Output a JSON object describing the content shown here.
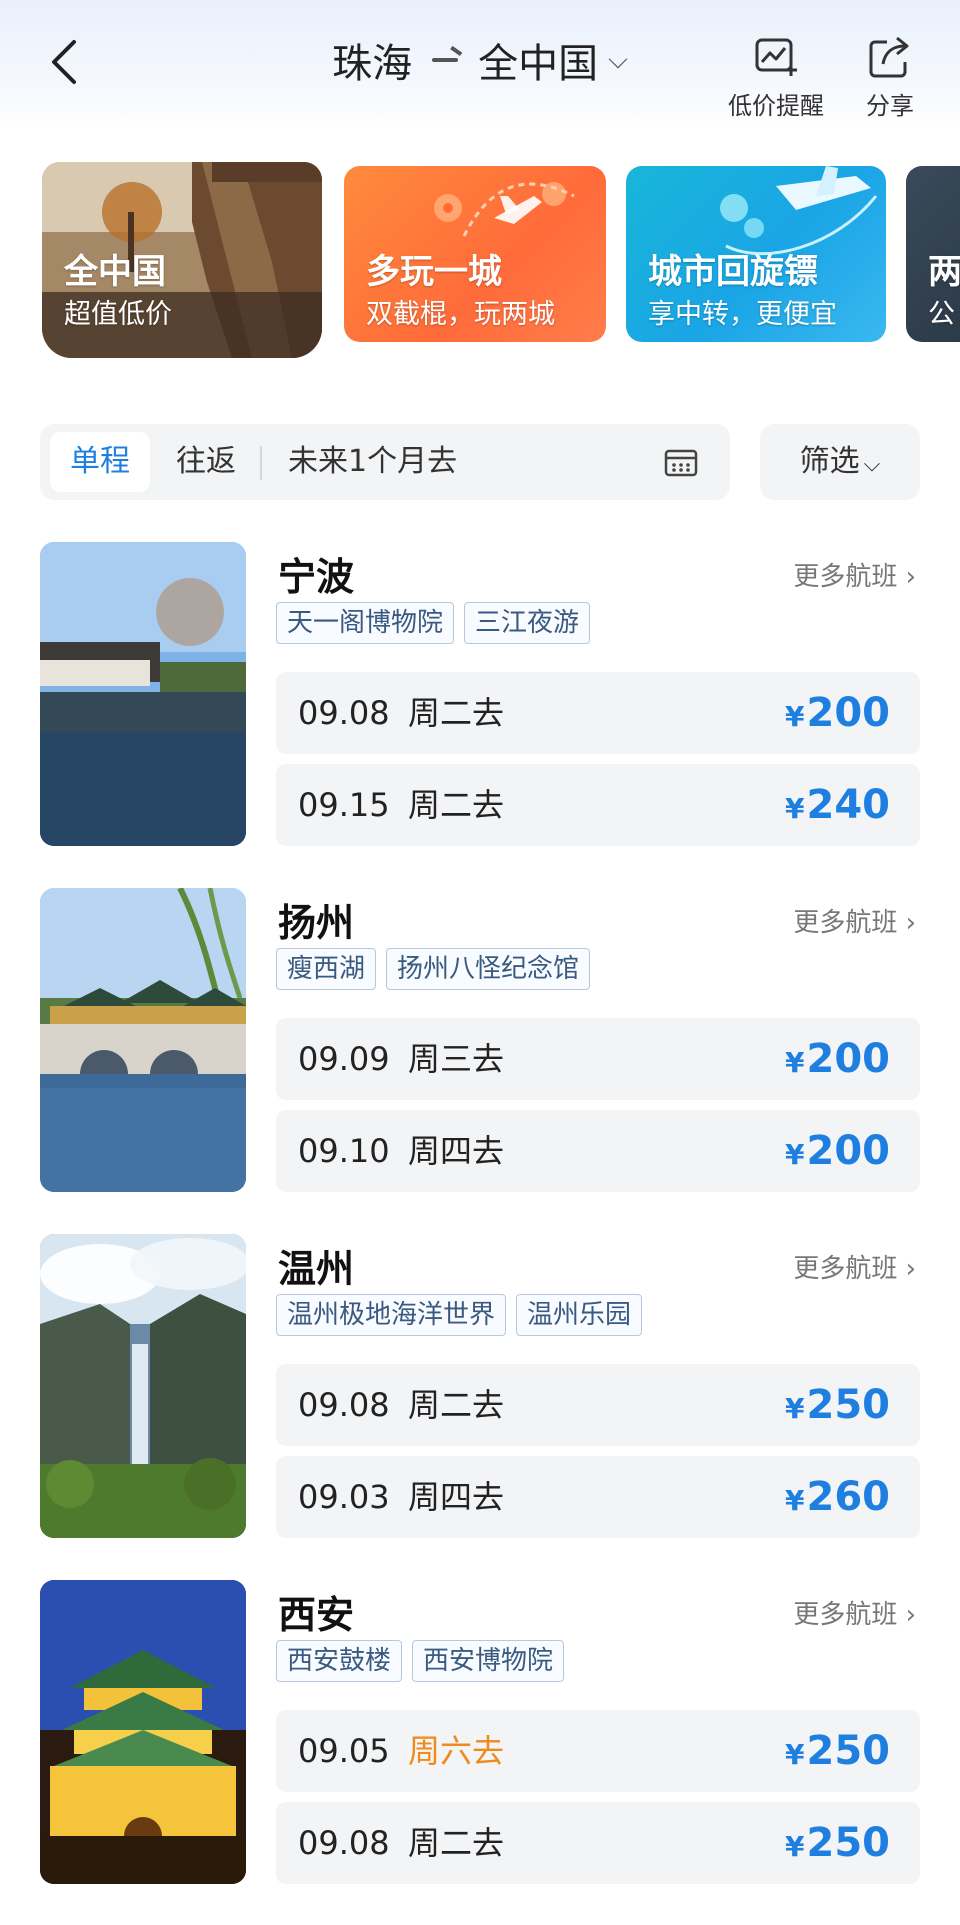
{
  "header": {
    "origin": "珠海",
    "destination": "全中国",
    "price_alert_label": "低价提醒",
    "share_label": "分享"
  },
  "categories": [
    {
      "title": "全中国",
      "subtitle": "超值低价"
    },
    {
      "title": "多玩一城",
      "subtitle": "双截棍，玩两城"
    },
    {
      "title": "城市回旋镖",
      "subtitle": "享中转，更便宜"
    },
    {
      "title": "两",
      "subtitle": "公"
    }
  ],
  "filter": {
    "one_way_label": "单程",
    "round_trip_label": "往返",
    "date_range_label": "未来1个月去",
    "filter_label": "筛选",
    "selected_trip": "单程"
  },
  "more_flights_label": "更多航班",
  "currency_symbol": "¥",
  "destinations": [
    {
      "city": "宁波",
      "tags": [
        "天一阁博物院",
        "三江夜游"
      ],
      "fares": [
        {
          "date": "09.08",
          "day": "周二去",
          "price": "200"
        },
        {
          "date": "09.15",
          "day": "周二去",
          "price": "240"
        }
      ]
    },
    {
      "city": "扬州",
      "tags": [
        "瘦西湖",
        "扬州八怪纪念馆"
      ],
      "fares": [
        {
          "date": "09.09",
          "day": "周三去",
          "price": "200"
        },
        {
          "date": "09.10",
          "day": "周四去",
          "price": "200"
        }
      ]
    },
    {
      "city": "温州",
      "tags": [
        "温州极地海洋世界",
        "温州乐园"
      ],
      "fares": [
        {
          "date": "09.08",
          "day": "周二去",
          "price": "250"
        },
        {
          "date": "09.03",
          "day": "周四去",
          "price": "260"
        }
      ]
    },
    {
      "city": "西安",
      "tags": [
        "西安鼓楼",
        "西安博物院"
      ],
      "fares": [
        {
          "date": "09.05",
          "day": "周六去",
          "price": "250"
        },
        {
          "date": "09.08",
          "day": "周二去",
          "price": "250"
        }
      ]
    }
  ],
  "colors": {
    "accent": "#1f7fe0",
    "weekend": "#f08a1c",
    "card_bg": "#f3f4f6"
  }
}
